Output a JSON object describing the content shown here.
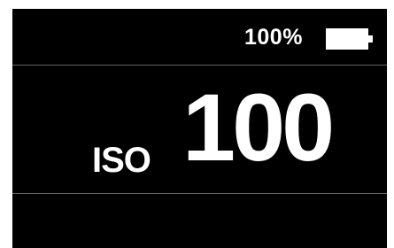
{
  "status": {
    "battery_percent_text": "100%",
    "battery_level": 1.0,
    "battery_icon": "battery-full-icon"
  },
  "display": {
    "iso_label": "ISO",
    "iso_value": "100"
  },
  "colors": {
    "background": "#000000",
    "text": "#ffffff",
    "divider": "#666666"
  }
}
